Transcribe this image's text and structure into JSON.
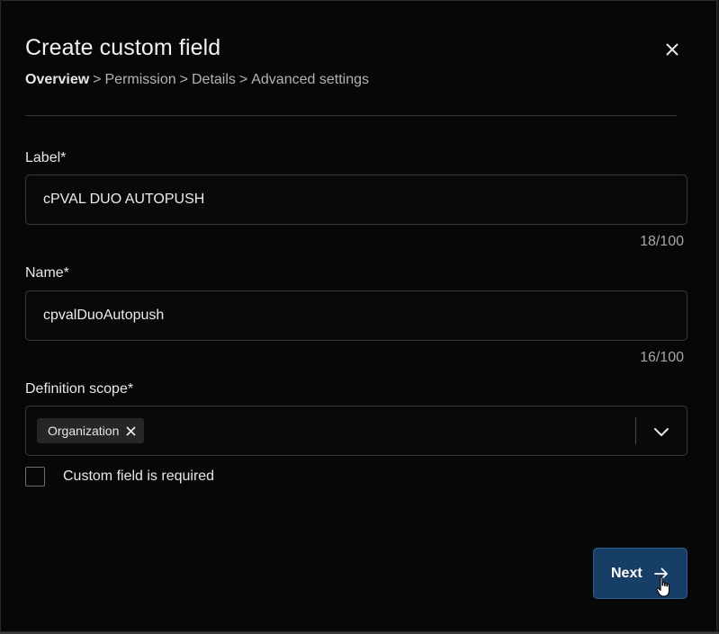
{
  "dialog": {
    "title": "Create custom field",
    "close_icon": "close-icon"
  },
  "breadcrumb": {
    "items": [
      "Overview",
      "Permission",
      "Details",
      "Advanced settings"
    ],
    "separator": ">",
    "current_index": 0
  },
  "label_field": {
    "label": "Label*",
    "value": "cPVAL DUO AUTOPUSH",
    "counter": "18/100"
  },
  "name_field": {
    "label": "Name*",
    "value": "cpvalDuoAutopush",
    "counter": "16/100"
  },
  "scope_field": {
    "label": "Definition scope*",
    "selected": [
      "Organization"
    ],
    "remove_icon": "close-icon",
    "toggle_icon": "chevron-down-icon"
  },
  "required_checkbox": {
    "label": "Custom field is required",
    "checked": false
  },
  "next_button": {
    "label": "Next",
    "icon": "arrow-right-icon"
  },
  "colors": {
    "background": "#070707",
    "primary_button": "#173e66",
    "border": "#3a3a3a"
  }
}
